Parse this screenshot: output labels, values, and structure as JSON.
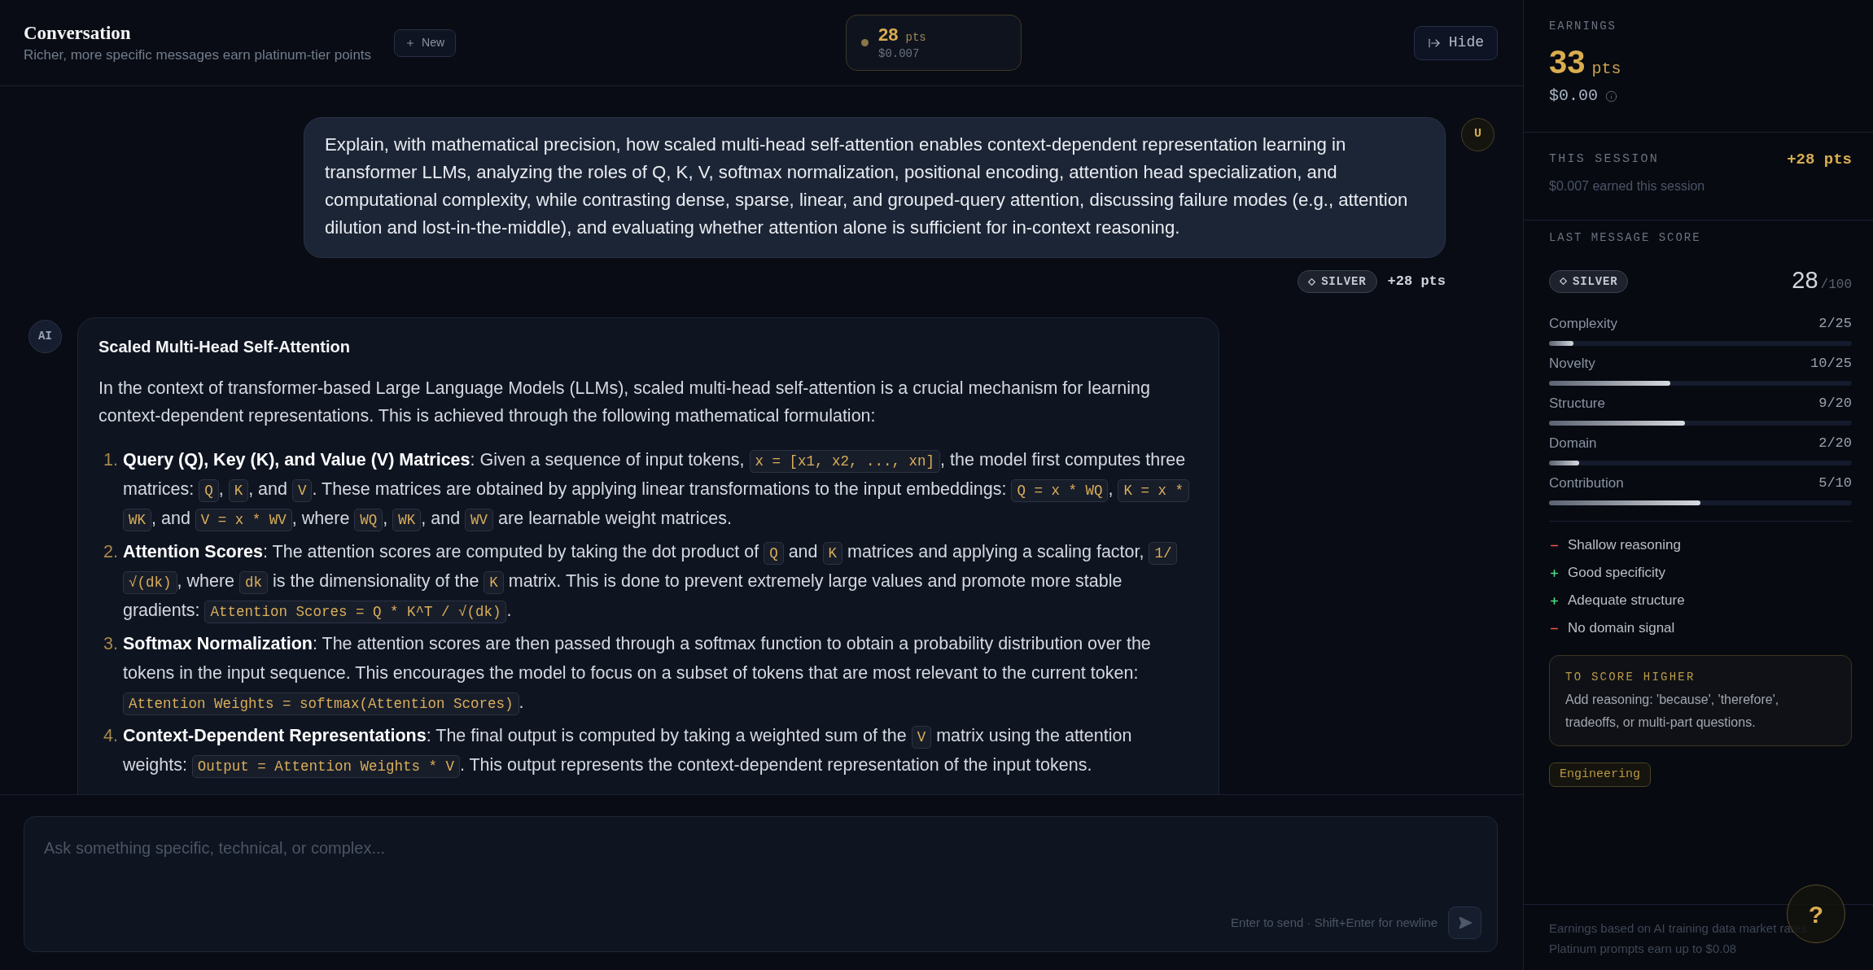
{
  "header": {
    "title": "Conversation",
    "subtitle": "Richer, more specific messages earn platinum-tier points",
    "new_button": "New",
    "points": {
      "value": "28",
      "unit": "pts",
      "money": "$0.007"
    },
    "hide_button": "Hide"
  },
  "messages": [
    {
      "kind": "user",
      "avatar": "U",
      "text": "Explain, with mathematical precision, how scaled multi-head self-attention enables context-dependent representation learning in transformer LLMs, analyzing the roles of Q, K, V, softmax normalization, positional encoding, attention head specialization, and computational complexity, while contrasting dense, sparse, linear, and grouped-query attention, discussing failure modes (e.g., attention dilution and lost-in-the-middle), and evaluating whether attention alone is sufficient for in-context reasoning.",
      "tier": "SILVER",
      "points": "+28 pts"
    },
    {
      "kind": "ai",
      "avatar": "AI",
      "blocks": [
        {
          "kind": "heading",
          "text": "Scaled Multi-Head Self-Attention"
        },
        {
          "kind": "paragraph",
          "text": "In the context of transformer-based Large Language Models (LLMs), scaled multi-head self-attention is a crucial mechanism for learning context-dependent representations. This is achieved through the following mathematical formulation:"
        },
        {
          "kind": "list",
          "items": [
            {
              "number": "1.",
              "segments": [
                {
                  "kind": "text",
                  "text": "**Query (Q), Key (K), and Value (V) Matrices**: Given a sequence of input tokens, "
                },
                {
                  "kind": "code",
                  "text": "x = [x1, x2, ..., xn]"
                },
                {
                  "kind": "text",
                  "text": ", the model first computes three matrices: "
                },
                {
                  "kind": "code",
                  "text": "Q"
                },
                {
                  "kind": "text",
                  "text": ", "
                },
                {
                  "kind": "code",
                  "text": "K"
                },
                {
                  "kind": "text",
                  "text": ", and "
                },
                {
                  "kind": "code",
                  "text": "V"
                },
                {
                  "kind": "text",
                  "text": ". These matrices are obtained by applying linear transformations to the input embeddings: "
                },
                {
                  "kind": "code",
                  "text": "Q = x * WQ"
                },
                {
                  "kind": "text",
                  "text": ", "
                },
                {
                  "kind": "code",
                  "text": "K = x * WK"
                },
                {
                  "kind": "text",
                  "text": ", and "
                },
                {
                  "kind": "code",
                  "text": "V = x * WV"
                },
                {
                  "kind": "text",
                  "text": ", where "
                },
                {
                  "kind": "code",
                  "text": "WQ"
                },
                {
                  "kind": "text",
                  "text": ", "
                },
                {
                  "kind": "code",
                  "text": "WK"
                },
                {
                  "kind": "text",
                  "text": ", and "
                },
                {
                  "kind": "code",
                  "text": "WV"
                },
                {
                  "kind": "text",
                  "text": " are learnable weight matrices."
                }
              ]
            },
            {
              "number": "2.",
              "segments": [
                {
                  "kind": "text",
                  "text": "**Attention Scores**: The attention scores are computed by taking the dot product of "
                },
                {
                  "kind": "code",
                  "text": "Q"
                },
                {
                  "kind": "text",
                  "text": " and "
                },
                {
                  "kind": "code",
                  "text": "K"
                },
                {
                  "kind": "text",
                  "text": " matrices and applying a scaling factor, "
                },
                {
                  "kind": "code",
                  "text": "1/√(dk)"
                },
                {
                  "kind": "text",
                  "text": ", where "
                },
                {
                  "kind": "code",
                  "text": "dk"
                },
                {
                  "kind": "text",
                  "text": " is the dimensionality of the "
                },
                {
                  "kind": "code",
                  "text": "K"
                },
                {
                  "kind": "text",
                  "text": " matrix. This is done to prevent extremely large values and promote more stable gradients: "
                },
                {
                  "kind": "code",
                  "text": "Attention Scores = Q * K^T / √(dk)"
                },
                {
                  "kind": "text",
                  "text": "."
                }
              ]
            },
            {
              "number": "3.",
              "segments": [
                {
                  "kind": "text",
                  "text": "**Softmax Normalization**: The attention scores are then passed through a softmax function to obtain a probability distribution over the tokens in the input sequence. This encourages the model to focus on a subset of tokens that are most relevant to the current token: "
                },
                {
                  "kind": "code",
                  "text": "Attention Weights = softmax(Attention Scores)"
                },
                {
                  "kind": "text",
                  "text": "."
                }
              ]
            },
            {
              "number": "4.",
              "segments": [
                {
                  "kind": "text",
                  "text": "**Context-Dependent Representations**: The final output is computed by taking a weighted sum of the "
                },
                {
                  "kind": "code",
                  "text": "V"
                },
                {
                  "kind": "text",
                  "text": " matrix using the attention weights: "
                },
                {
                  "kind": "code",
                  "text": "Output = Attention Weights * V"
                },
                {
                  "kind": "text",
                  "text": ". This output represents the context-dependent representation of the input tokens."
                }
              ]
            }
          ]
        }
      ]
    }
  ],
  "composer": {
    "placeholder": "Ask something specific, technical, or complex...",
    "hint": "Enter to send · Shift+Enter for newline"
  },
  "sidebar": {
    "earnings": {
      "label": "EARNINGS",
      "value": "33",
      "unit": "pts",
      "money": "$0.00"
    },
    "session": {
      "label": "THIS SESSION",
      "points": "+28 pts",
      "note": "$0.007 earned this session"
    },
    "last_score": {
      "label": "LAST MESSAGE SCORE",
      "tier": "SILVER",
      "score": "28",
      "max": "/100",
      "metrics": [
        {
          "name": "Complexity",
          "reading": "2/25",
          "level": 0.08
        },
        {
          "name": "Novelty",
          "reading": "10/25",
          "level": 0.4
        },
        {
          "name": "Structure",
          "reading": "9/20",
          "level": 0.45
        },
        {
          "name": "Domain",
          "reading": "2/20",
          "level": 0.1
        },
        {
          "name": "Contribution",
          "reading": "5/10",
          "level": 0.5
        }
      ],
      "feedback": [
        {
          "kind": "negative",
          "text": "Shallow reasoning"
        },
        {
          "kind": "positive",
          "text": "Good specificity"
        },
        {
          "kind": "positive",
          "text": "Adequate structure"
        },
        {
          "kind": "negative",
          "text": "No domain signal"
        }
      ],
      "tip": {
        "title": "TO SCORE HIGHER",
        "text": "Add reasoning: 'because', 'therefore', tradeoffs, or multi-part questions."
      },
      "tags": [
        "Engineering"
      ]
    },
    "footer": "Earnings based on AI training data market rates · Platinum prompts earn up to $0.08"
  },
  "help_button": "?"
}
